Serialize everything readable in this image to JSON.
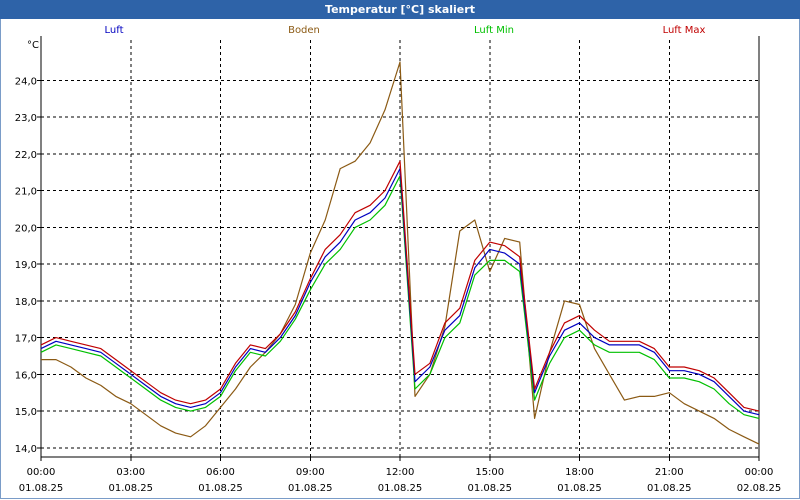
{
  "window": {
    "title": "Temperatur [°C] skaliert"
  },
  "chart_data": {
    "type": "line",
    "title": "Temperatur [°C] skaliert",
    "ylabel": "°C",
    "xlabel": "",
    "ylim": [
      13.75,
      25.1
    ],
    "yticks": [
      "14,0",
      "15,0",
      "16,0",
      "17,0",
      "18,0",
      "19,0",
      "20,0",
      "21,0",
      "22,0",
      "23,0",
      "24,0"
    ],
    "xticks": [
      {
        "time": "00:00",
        "date": "01.08.25"
      },
      {
        "time": "03:00",
        "date": "01.08.25"
      },
      {
        "time": "06:00",
        "date": "01.08.25"
      },
      {
        "time": "09:00",
        "date": "01.08.25"
      },
      {
        "time": "12:00",
        "date": "01.08.25"
      },
      {
        "time": "15:00",
        "date": "01.08.25"
      },
      {
        "time": "18:00",
        "date": "01.08.25"
      },
      {
        "time": "21:00",
        "date": "01.08.25"
      },
      {
        "time": "00:00",
        "date": "02.08.25"
      }
    ],
    "x_hours": [
      0,
      0.5,
      1,
      1.5,
      2,
      2.5,
      3,
      3.5,
      4,
      4.5,
      5,
      5.5,
      6,
      6.5,
      7,
      7.5,
      8,
      8.5,
      9,
      9.5,
      10,
      10.5,
      11,
      11.5,
      12,
      12.5,
      13,
      13.5,
      14,
      14.5,
      15,
      15.5,
      16,
      16.5,
      17,
      17.5,
      18,
      18.5,
      19,
      19.5,
      20,
      20.5,
      21,
      21.5,
      22,
      22.5,
      23,
      23.5,
      24
    ],
    "grid": true,
    "legend": "top",
    "series": [
      {
        "name": "Luft",
        "color": "#0000c0",
        "values": [
          16.7,
          16.9,
          16.8,
          16.7,
          16.6,
          16.3,
          16.0,
          15.7,
          15.4,
          15.2,
          15.1,
          15.2,
          15.5,
          16.2,
          16.7,
          16.6,
          17.0,
          17.6,
          18.5,
          19.2,
          19.6,
          20.2,
          20.4,
          20.8,
          21.6,
          15.8,
          16.2,
          17.2,
          17.6,
          18.9,
          19.4,
          19.3,
          19.0,
          15.5,
          16.5,
          17.2,
          17.4,
          17.0,
          16.8,
          16.8,
          16.8,
          16.6,
          16.1,
          16.1,
          16.0,
          15.8,
          15.4,
          15.0,
          14.9
        ]
      },
      {
        "name": "Boden",
        "color": "#8b5a14",
        "values": [
          16.4,
          16.4,
          16.2,
          15.9,
          15.7,
          15.4,
          15.2,
          14.9,
          14.6,
          14.4,
          14.3,
          14.6,
          15.1,
          15.6,
          16.2,
          16.6,
          17.1,
          17.9,
          19.3,
          20.2,
          21.6,
          21.8,
          22.3,
          23.2,
          24.5,
          15.4,
          16.0,
          17.3,
          19.9,
          20.2,
          18.8,
          19.7,
          19.6,
          14.8,
          16.6,
          18.0,
          17.9,
          16.7,
          16.0,
          15.3,
          15.4,
          15.4,
          15.5,
          15.2,
          15.0,
          14.8,
          14.5,
          14.3,
          14.1
        ]
      },
      {
        "name": "Luft Min",
        "color": "#00c000",
        "values": [
          16.6,
          16.8,
          16.7,
          16.6,
          16.5,
          16.2,
          15.9,
          15.6,
          15.3,
          15.1,
          15.0,
          15.1,
          15.4,
          16.1,
          16.6,
          16.5,
          16.9,
          17.5,
          18.3,
          19.0,
          19.4,
          20.0,
          20.2,
          20.6,
          21.4,
          15.6,
          16.0,
          17.0,
          17.4,
          18.7,
          19.1,
          19.1,
          18.8,
          15.3,
          16.3,
          17.0,
          17.2,
          16.8,
          16.6,
          16.6,
          16.6,
          16.4,
          15.9,
          15.9,
          15.8,
          15.6,
          15.2,
          14.9,
          14.8
        ]
      },
      {
        "name": "Luft Max",
        "color": "#c00000",
        "values": [
          16.8,
          17.0,
          16.9,
          16.8,
          16.7,
          16.4,
          16.1,
          15.8,
          15.5,
          15.3,
          15.2,
          15.3,
          15.6,
          16.3,
          16.8,
          16.7,
          17.1,
          17.7,
          18.6,
          19.4,
          19.8,
          20.4,
          20.6,
          21.0,
          21.8,
          16.0,
          16.3,
          17.4,
          17.8,
          19.1,
          19.6,
          19.5,
          19.2,
          15.6,
          16.6,
          17.4,
          17.6,
          17.2,
          16.9,
          16.9,
          16.9,
          16.7,
          16.2,
          16.2,
          16.1,
          15.9,
          15.5,
          15.1,
          15.0
        ]
      }
    ]
  }
}
